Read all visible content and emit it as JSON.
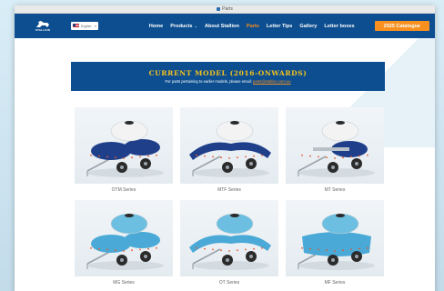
{
  "browser": {
    "tab_title": "Parts"
  },
  "site": {
    "logo_text": "STALLION",
    "language": "English",
    "nav": [
      {
        "label": "Home"
      },
      {
        "label": "Products",
        "has_dropdown": true
      },
      {
        "label": "About Stallion"
      },
      {
        "label": "Parts",
        "active": true
      },
      {
        "label": "Letter Tips"
      },
      {
        "label": "Gallery"
      },
      {
        "label": "Letter boxes"
      }
    ],
    "catalogue_button": "2025 Catalogue"
  },
  "banner": {
    "heading": "CURRENT MODEL (2016-ONWARDS)",
    "subtext": "For parts pertaining to earlier models, please email:",
    "email": "parts@stallion.com.au"
  },
  "products": [
    {
      "label": "OTM Series",
      "tank_color": "#f3f3f3",
      "body_color": "#1f3f8a",
      "style": "outboard"
    },
    {
      "label": "MTF Series",
      "tank_color": "#f3f3f3",
      "body_color": "#1f3f8a",
      "style": "wide"
    },
    {
      "label": "MT Series",
      "tank_color": "#f3f3f3",
      "body_color": "#1f3f8a",
      "style": "compact"
    },
    {
      "label": "MG Series",
      "tank_color": "#6cbfe0",
      "body_color": "#4aa9d6",
      "style": "outboard"
    },
    {
      "label": "OT Series",
      "tank_color": "#6cbfe0",
      "body_color": "#4aa9d6",
      "style": "wide"
    },
    {
      "label": "MF Series",
      "tank_color": "#6cbfe0",
      "body_color": "#4aa9d6",
      "style": "tall"
    }
  ],
  "colors": {
    "brand_blue": "#0c4e8f",
    "accent_orange": "#f7901e",
    "banner_heading": "#f7c21e"
  }
}
